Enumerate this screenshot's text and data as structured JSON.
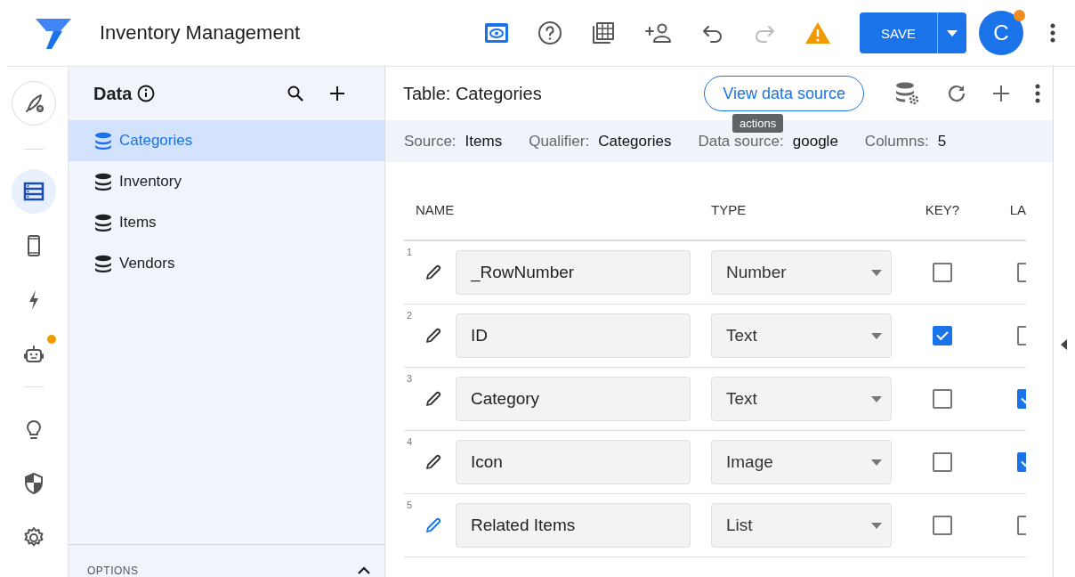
{
  "app": {
    "title": "Inventory Management",
    "save_label": "SAVE",
    "avatar": "C"
  },
  "rail": [
    {
      "selected": false,
      "badge": false
    },
    {
      "selected": true,
      "badge": false
    },
    {
      "selected": false,
      "badge": false
    },
    {
      "selected": false,
      "badge": false
    },
    {
      "selected": false,
      "badge": true
    },
    {
      "selected": false,
      "badge": false
    },
    {
      "selected": false,
      "badge": false
    },
    {
      "selected": false,
      "badge": false
    }
  ],
  "data_panel": {
    "title": "Data",
    "tables": [
      {
        "label": "Categories",
        "selected": true
      },
      {
        "label": "Inventory",
        "selected": false
      },
      {
        "label": "Items",
        "selected": false
      },
      {
        "label": "Vendors",
        "selected": false
      }
    ],
    "options_label": "OPTIONS"
  },
  "table": {
    "title": "Table: Categories",
    "view_button": "View data source",
    "tooltip": "actions",
    "info": [
      {
        "label": "Source:",
        "value": "Items"
      },
      {
        "label": "Qualifier:",
        "value": "Categories"
      },
      {
        "label": "Data source:",
        "value": "google"
      },
      {
        "label": "Columns:",
        "value": "5"
      }
    ],
    "columns": [
      "NAME",
      "TYPE",
      "KEY?",
      "LA"
    ],
    "rows": [
      {
        "number": "1",
        "name": "_RowNumber",
        "type": "Number",
        "key": false,
        "label": false,
        "selected": false
      },
      {
        "number": "2",
        "name": "ID",
        "type": "Text",
        "key": true,
        "label": false,
        "selected": false
      },
      {
        "number": "3",
        "name": "Category",
        "type": "Text",
        "key": false,
        "label": true,
        "selected": false
      },
      {
        "number": "4",
        "name": "Icon",
        "type": "Image",
        "key": false,
        "label": true,
        "selected": false
      },
      {
        "number": "5",
        "name": "Related Items",
        "type": "List",
        "key": false,
        "label": false,
        "selected": true
      }
    ]
  }
}
